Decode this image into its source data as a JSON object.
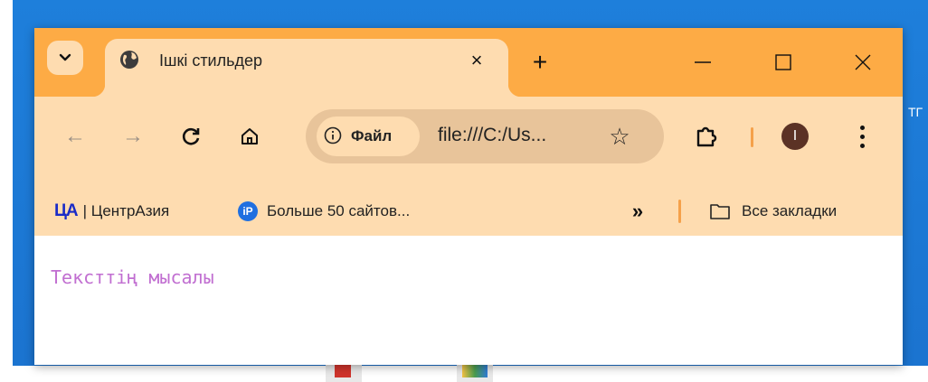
{
  "desktop": {
    "edge_text": "ТГ"
  },
  "tab": {
    "title": "Ішкі стильдер",
    "close_glyph": "×"
  },
  "titlebar": {
    "new_tab_glyph": "+"
  },
  "toolbar": {
    "back_glyph": "←",
    "forward_glyph": "→",
    "reload_glyph": "C",
    "chip_label": "Файл",
    "url": "file:///C:/Us...",
    "star_glyph": "☆",
    "avatar_letter": "I"
  },
  "bookmarks": {
    "item1_logo": "ЦА",
    "item1_label": "| ЦентрАзия",
    "item2_logo": "iP",
    "item2_label": "Больше 50 сайтов...",
    "more_glyph": "»",
    "all_label": "Все закладки"
  },
  "content": {
    "sample_text": "Тексттің мысалы"
  },
  "colors": {
    "titlebar": "#fdab45",
    "toolbar": "#fedcb0",
    "omnibox": "#e8c49a",
    "sample_text": "#c16fd1",
    "separator": "#f5a14a"
  }
}
